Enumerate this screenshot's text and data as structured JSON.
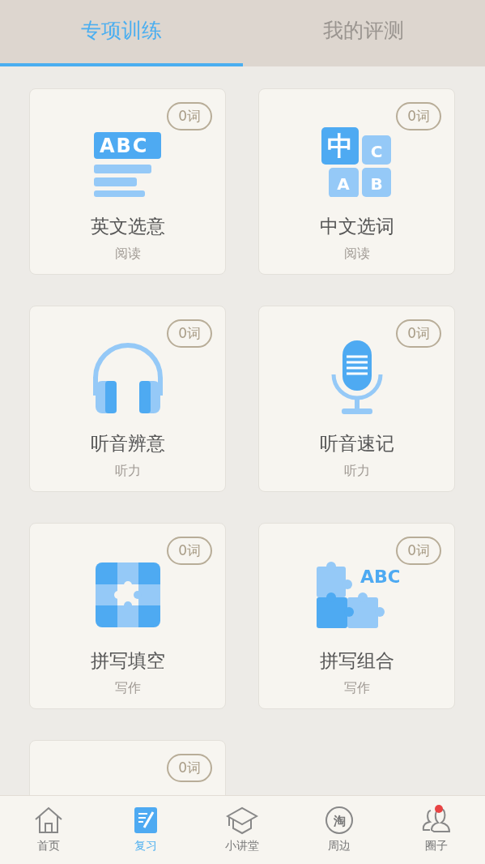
{
  "tabs": [
    {
      "label": "专项训练",
      "selected": true
    },
    {
      "label": "我的评测",
      "selected": false
    }
  ],
  "cards": [
    {
      "kind": "reading",
      "icon_text": [
        "ABC"
      ],
      "badge": "0词",
      "title": "英文选意",
      "subtitle": "阅读"
    },
    {
      "kind": "chinese",
      "icon_text": [
        "中",
        "C",
        "A",
        "B"
      ],
      "badge": "0词",
      "title": "中文选词",
      "subtitle": "阅读"
    },
    {
      "kind": "headphones",
      "badge": "0词",
      "title": "听音辨意",
      "subtitle": "听力"
    },
    {
      "kind": "mic",
      "badge": "0词",
      "title": "听音速记",
      "subtitle": "听力"
    },
    {
      "kind": "puzzle",
      "badge": "0词",
      "title": "拼写填空",
      "subtitle": "写作"
    },
    {
      "kind": "puzzle-abc",
      "icon_text": [
        "ABC"
      ],
      "badge": "0词",
      "title": "拼写组合",
      "subtitle": "写作"
    },
    {
      "badge": "0词"
    }
  ],
  "bottom_nav": [
    {
      "kind": "home",
      "label": "首页",
      "selected": false,
      "dot": false
    },
    {
      "kind": "review",
      "label": "复习",
      "selected": true,
      "dot": false
    },
    {
      "kind": "cap",
      "label": "小讲堂",
      "selected": false,
      "dot": false
    },
    {
      "kind": "tao",
      "icon_text": "淘",
      "label": "周边",
      "selected": false,
      "dot": false
    },
    {
      "kind": "people",
      "label": "圈子",
      "selected": false,
      "dot": true
    }
  ]
}
